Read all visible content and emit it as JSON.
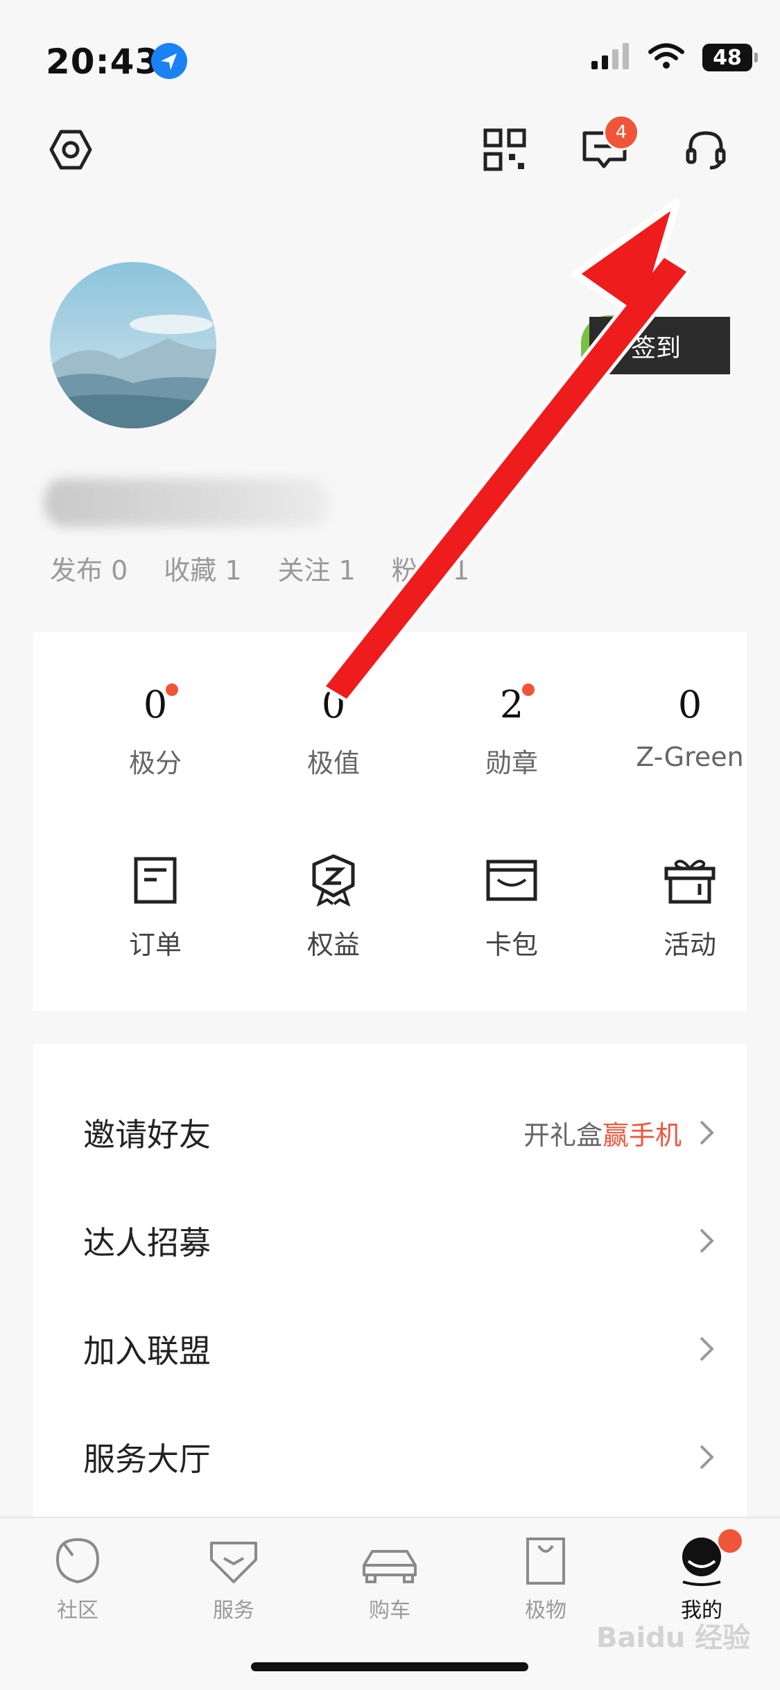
{
  "status_bar": {
    "time": "20:43",
    "battery": "48"
  },
  "header": {
    "message_badge_count": "4"
  },
  "profile": {
    "signin_label": "签到"
  },
  "profile_stats": {
    "posts": "发布 0",
    "favorites": "收藏 1",
    "following": "关注 1",
    "fans": "粉丝 1"
  },
  "metrics": [
    {
      "value": "0",
      "label": "极分",
      "has_dot": true
    },
    {
      "value": "0",
      "label": "极值",
      "has_dot": true
    },
    {
      "value": "2",
      "label": "勋章",
      "has_dot": true
    },
    {
      "value": "0",
      "label": "Z-Green",
      "has_dot": false
    }
  ],
  "tools": [
    {
      "label": "订单",
      "icon": "order-icon"
    },
    {
      "label": "权益",
      "icon": "benefits-icon"
    },
    {
      "label": "卡包",
      "icon": "card-wallet-icon"
    },
    {
      "label": "活动",
      "icon": "gift-icon"
    }
  ],
  "menu": [
    {
      "label": "邀请好友",
      "promo_a": "开礼盒",
      "promo_b": "赢手机"
    },
    {
      "label": "达人招募"
    },
    {
      "label": "加入联盟"
    },
    {
      "label": "服务大厅"
    }
  ],
  "tabs": [
    {
      "label": "社区",
      "icon": "community-icon"
    },
    {
      "label": "服务",
      "icon": "service-icon"
    },
    {
      "label": "购车",
      "icon": "car-icon"
    },
    {
      "label": "极物",
      "icon": "shopping-bag-icon"
    },
    {
      "label": "我的",
      "icon": "profile-icon",
      "active": true
    }
  ],
  "watermark": "Baidu 经验",
  "colors": {
    "accent": "#f0553a",
    "arrow": "#ee1c1c",
    "location": "#1a82f5"
  }
}
